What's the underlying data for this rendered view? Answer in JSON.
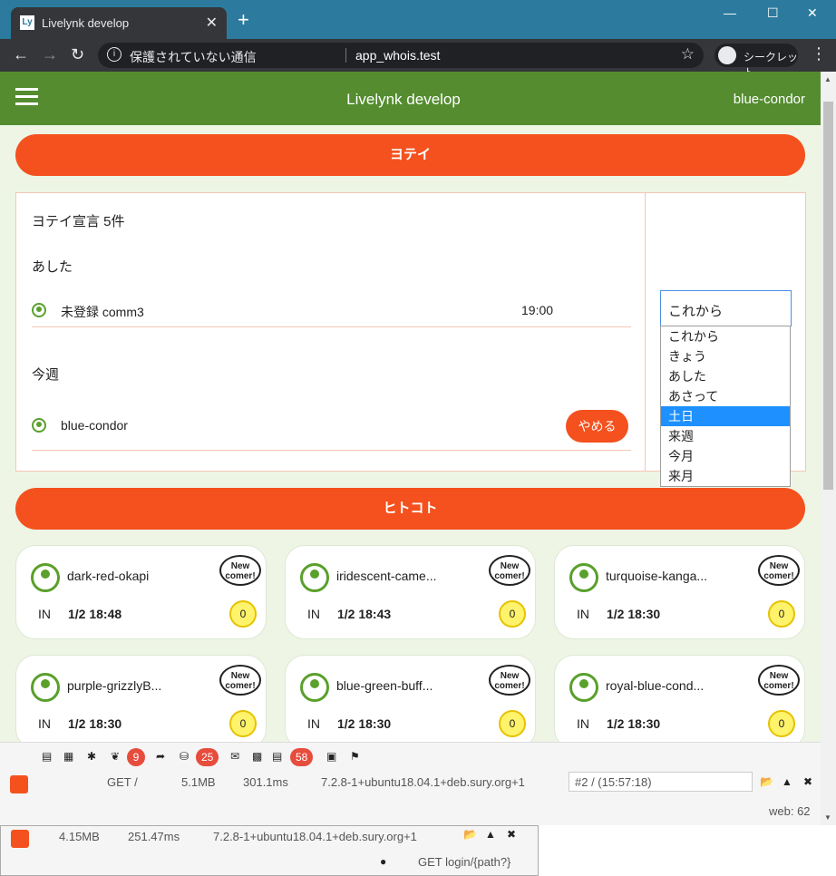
{
  "browser": {
    "tab_title": "Livelynk develop",
    "tab_close": "✕",
    "new_tab": "+",
    "win_min": "—",
    "win_max": "☐",
    "win_close": "✕",
    "insecure_label": "保護されていない通信",
    "url": "app_whois.test",
    "incognito_label": "シークレット"
  },
  "app": {
    "title": "Livelynk develop",
    "user": "blue-condor"
  },
  "yotei": {
    "header": "ヨテイ",
    "count_label": "ヨテイ宣言 5件",
    "groups": [
      {
        "label": "あした",
        "rows": [
          {
            "name": "未登録 comm3",
            "time": "19:00"
          }
        ]
      },
      {
        "label": "今週",
        "rows": [
          {
            "name": "blue-condor",
            "button": "やめる"
          }
        ]
      }
    ],
    "select_value": "これから",
    "options": [
      "これから",
      "きょう",
      "あした",
      "あさって",
      "土日",
      "来週",
      "今月",
      "来月"
    ],
    "highlighted_option": "土日"
  },
  "hitokoto": {
    "header": "ヒトコト",
    "cards": [
      {
        "name": "dark-red-okapi",
        "status": "IN",
        "datetime": "1/2 18:48",
        "count": "0",
        "badge": "New comer!"
      },
      {
        "name": "iridescent-came...",
        "status": "IN",
        "datetime": "1/2 18:43",
        "count": "0",
        "badge": "New comer!"
      },
      {
        "name": "turquoise-kanga...",
        "status": "IN",
        "datetime": "1/2 18:30",
        "count": "0",
        "badge": "New comer!"
      },
      {
        "name": "purple-grizzlyB...",
        "status": "IN",
        "datetime": "1/2 18:30",
        "count": "0",
        "badge": "New comer!"
      },
      {
        "name": "blue-green-buff...",
        "status": "IN",
        "datetime": "1/2 18:30",
        "count": "0",
        "badge": "New comer!"
      },
      {
        "name": "royal-blue-cond...",
        "status": "IN",
        "datetime": "1/2 18:30",
        "count": "0",
        "badge": "New comer!"
      }
    ]
  },
  "debugbar": {
    "badge_views": "9",
    "badge_queries": "25",
    "badge_messages": "58",
    "method": "GET /",
    "memory": "5.1MB",
    "time": "301.1ms",
    "php": "7.2.8-1+ubuntu18.04.1+deb.sury.org+1",
    "request": "#2 / (15:57:18)",
    "guard": "web: 62"
  },
  "debugbar2": {
    "memory": "4.15MB",
    "time": "251.47ms",
    "php": "7.2.8-1+ubuntu18.04.1+deb.sury.org+1",
    "route": "GET login/{path?}"
  },
  "colors": {
    "tab_bar": "#2c7b9e",
    "app_bar": "#548c2f",
    "accent": "#f4511e",
    "page_bg": "#eef5e5",
    "option_highlight": "#1e90ff"
  }
}
